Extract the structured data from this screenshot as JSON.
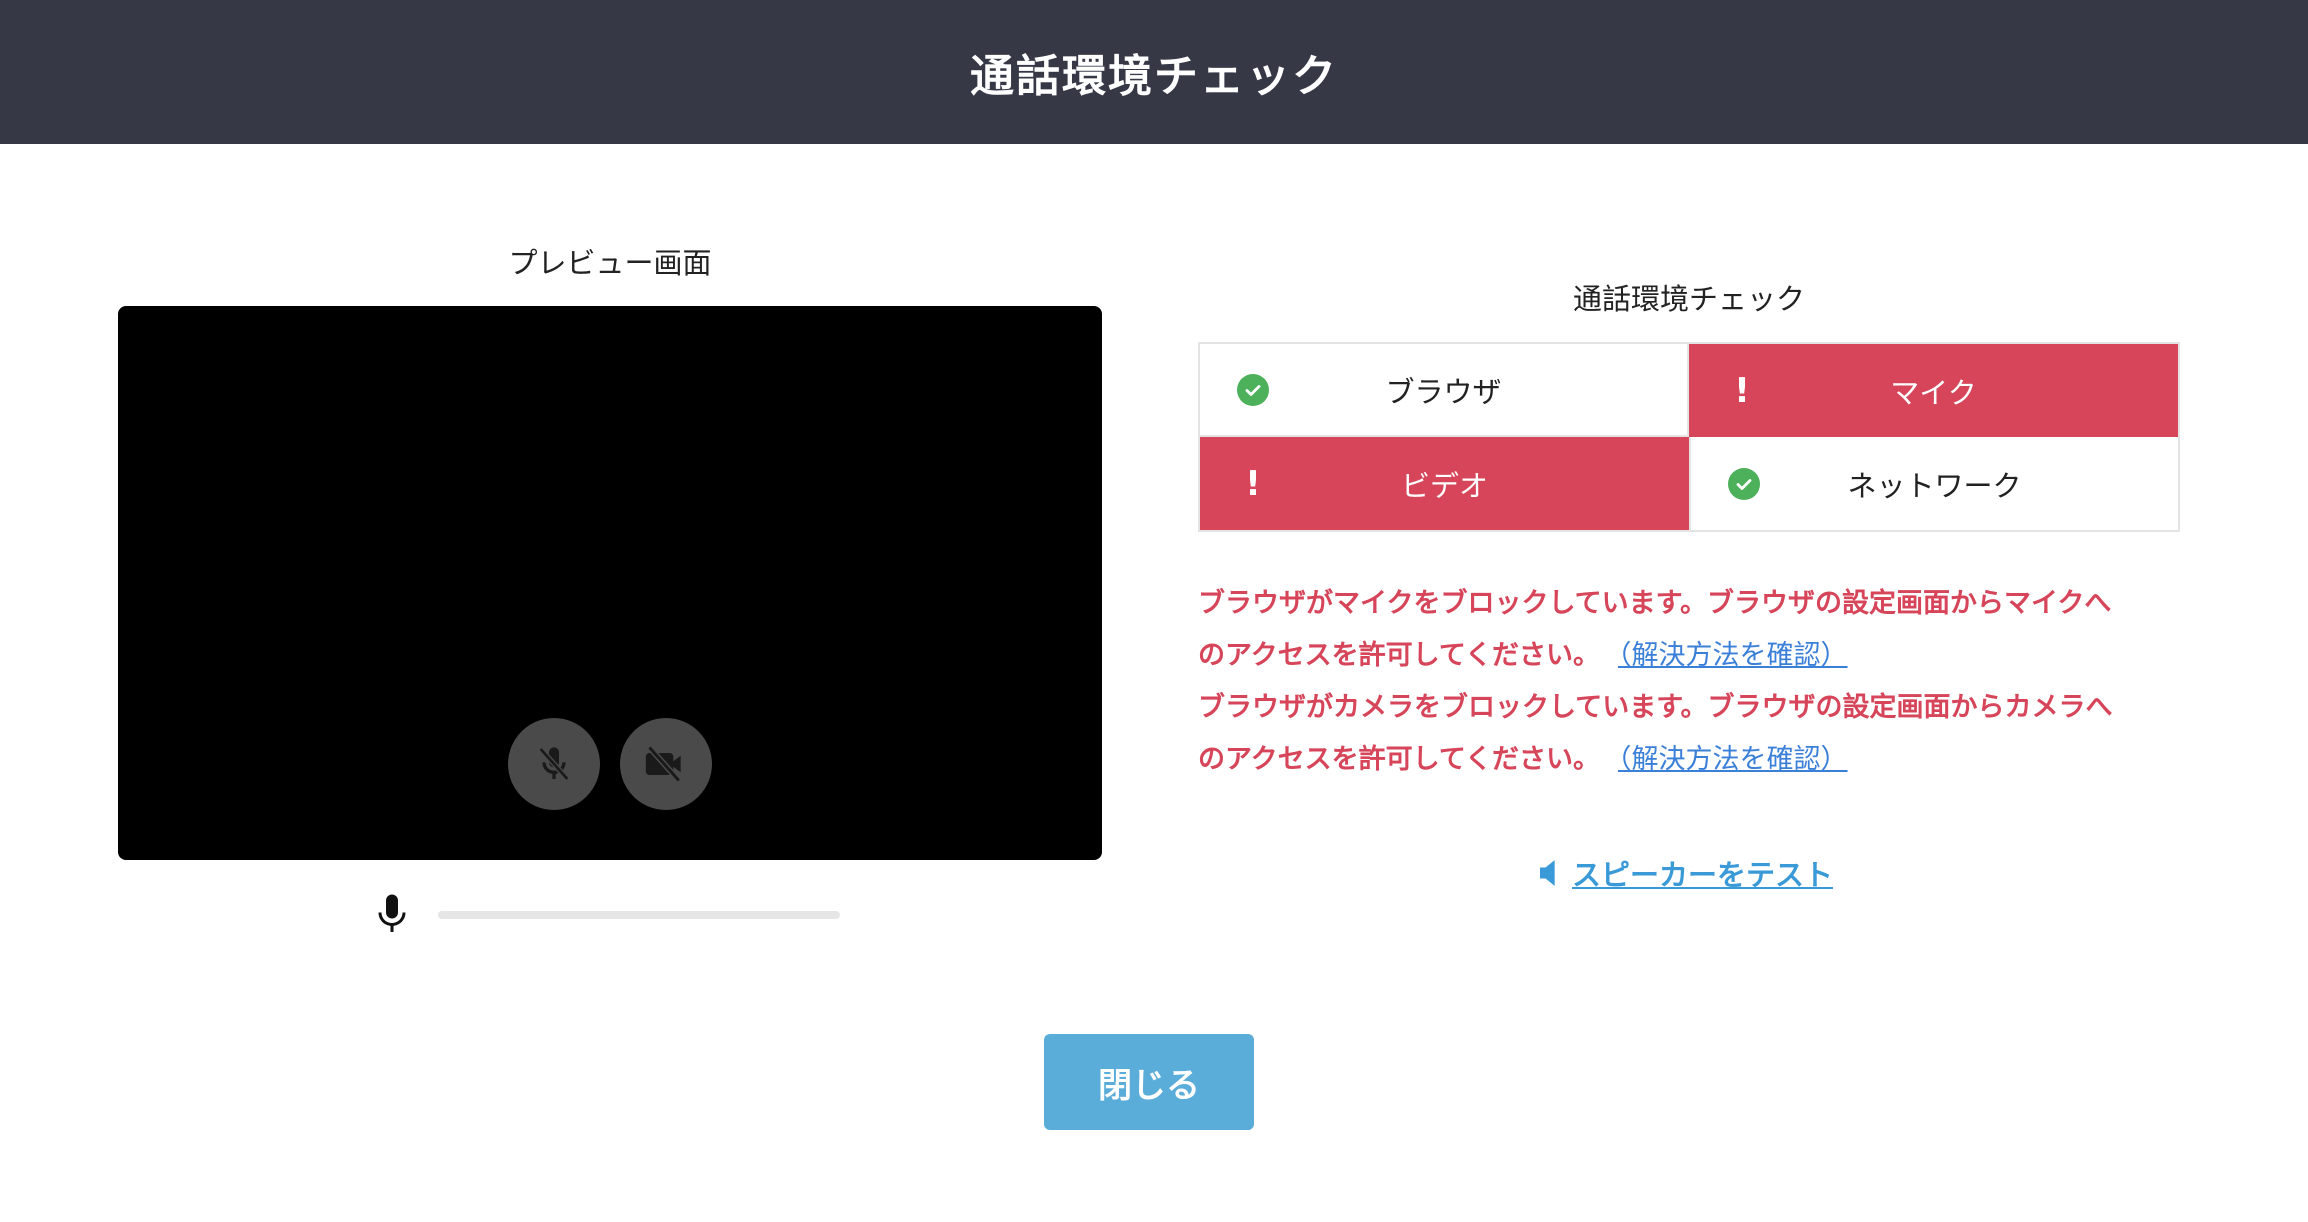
{
  "header": {
    "title": "通話環境チェック"
  },
  "preview": {
    "title": "プレビュー画面",
    "mic_level": 0
  },
  "check": {
    "title": "通話環境チェック",
    "items": [
      {
        "label": "ブラウザ",
        "status": "ok"
      },
      {
        "label": "マイク",
        "status": "error"
      },
      {
        "label": "ビデオ",
        "status": "error"
      },
      {
        "label": "ネットワーク",
        "status": "ok"
      }
    ],
    "status_colors": {
      "ok": "#4db05a",
      "error": "#d64559"
    }
  },
  "messages": [
    {
      "line1": "ブラウザがマイクをブロックしています。ブラウザの設定画面からマイクへ",
      "line2": "のアクセスを許可してください。",
      "link": "（解決方法を確認）"
    },
    {
      "line1": "ブラウザがカメラをブロックしています。ブラウザの設定画面からカメラへ",
      "line2": "のアクセスを許可してください。",
      "link": "（解決方法を確認）"
    }
  ],
  "speaker_test": {
    "label": "スピーカーをテスト"
  },
  "close_button": {
    "label": "閉じる"
  },
  "colors": {
    "header_bg": "#363846",
    "error": "#d64559",
    "link": "#3a7fd8",
    "button": "#5aacd9"
  },
  "icons": [
    "mic-off-icon",
    "camera-off-icon",
    "mic-icon",
    "check-circle-icon",
    "exclamation-icon",
    "speaker-icon"
  ]
}
